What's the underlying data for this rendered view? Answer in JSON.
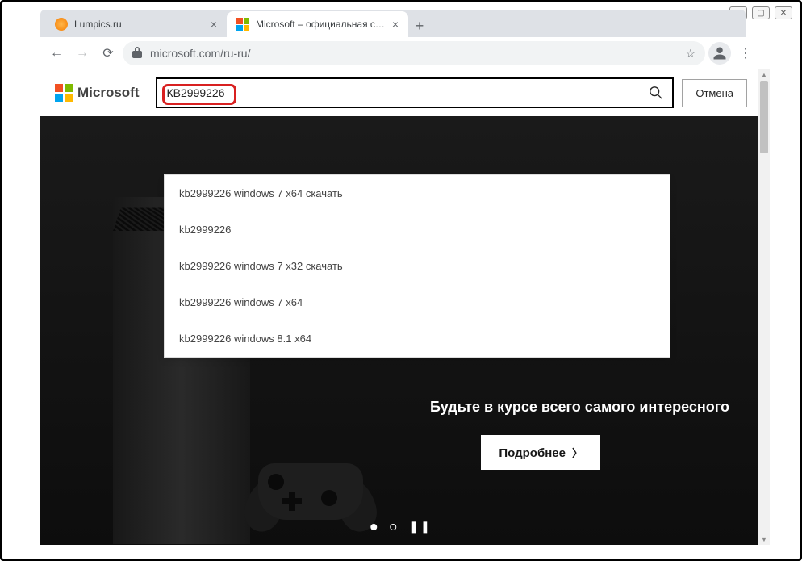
{
  "window": {
    "tabs": [
      {
        "title": "Lumpics.ru",
        "active": false,
        "favicon": "orange"
      },
      {
        "title": "Microsoft – официальная стран",
        "active": true,
        "favicon": "ms"
      }
    ]
  },
  "addressBar": {
    "url": "microsoft.com/ru-ru/"
  },
  "page": {
    "logoText": "Microsoft",
    "search": {
      "value": "КВ2999226",
      "cancelLabel": "Отмена",
      "suggestions": [
        "kb2999226 windows 7 x64 скачать",
        "kb2999226",
        "kb2999226 windows 7 x32 скачать",
        "kb2999226 windows 7 x64",
        "kb2999226 windows 8.1 x64"
      ]
    },
    "hero": {
      "headline": "Будьте в курсе всего самого интересного",
      "ctaLabel": "Подробнее"
    }
  }
}
